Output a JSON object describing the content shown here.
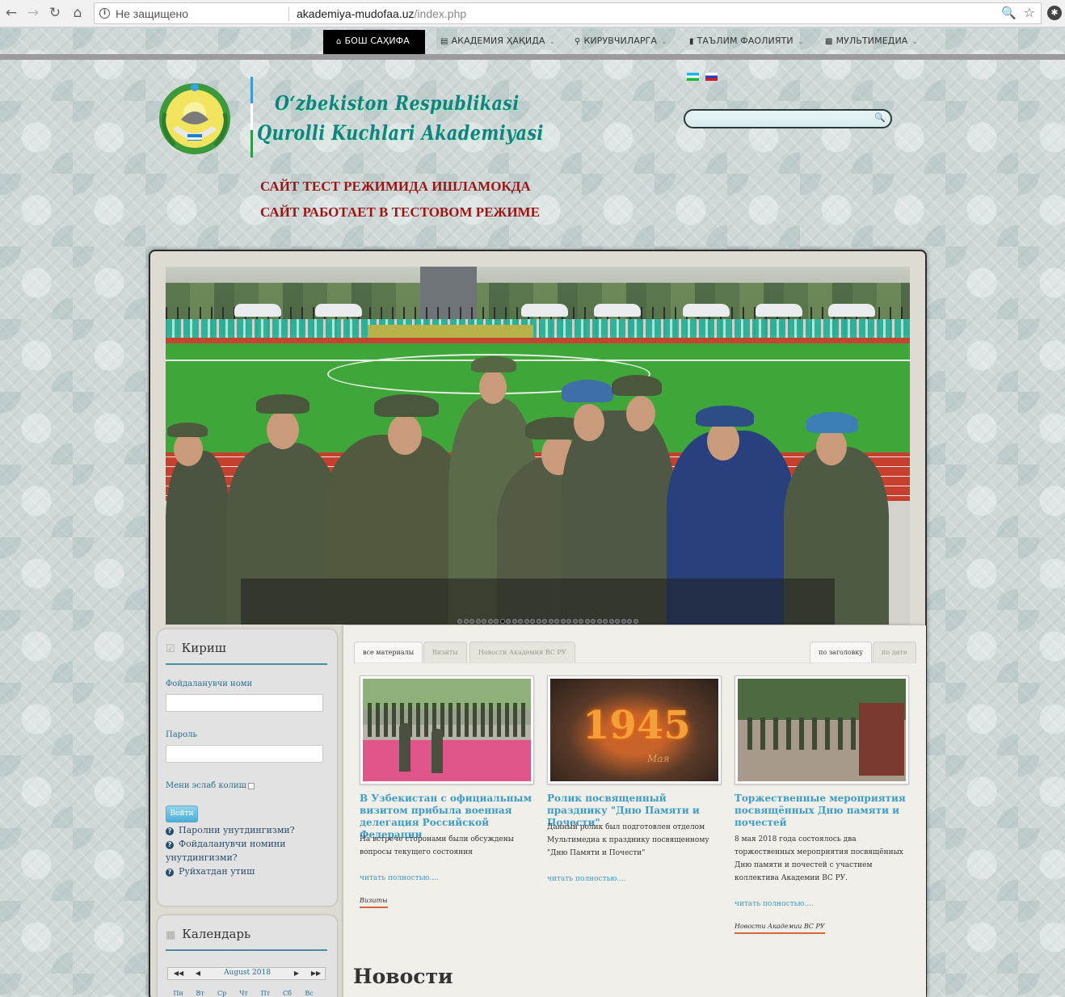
{
  "browser": {
    "security_label": "Не защищено",
    "url_domain": "akademiya-mudofaa.uz",
    "url_path": "/index.php"
  },
  "nav": {
    "items": [
      {
        "label": "БОШ САҲИФА",
        "icon": "home-icon"
      },
      {
        "label": "АКАДЕМИЯ ҲАҚИДА",
        "icon": "list-icon"
      },
      {
        "label": "КИРУВЧИЛАРГА",
        "icon": "search-icon"
      },
      {
        "label": "ТАЪЛИМ ФАОЛИЯТИ",
        "icon": "book-icon"
      },
      {
        "label": "МУЛЬТИМЕДИА",
        "icon": "camera-icon"
      }
    ]
  },
  "header": {
    "logo_line1": "O‘zbekiston Respublikasi",
    "logo_line2": "Qurolli Kuchlari Akademiyasi",
    "notice_uz": "САЙТ ТЕСТ РЕЖИМИДА ИШЛАМОКДА",
    "notice_ru": "САЙТ РАБОТАЕТ В ТЕСТОВОМ РЕЖИМЕ",
    "languages": [
      "uz",
      "ru"
    ]
  },
  "login": {
    "title": "Кириш",
    "username_label": "Фойдаланувчи номи",
    "password_label": "Пароль",
    "remember_label": "Мени эслаб колиш",
    "submit_label": "Войти",
    "links": [
      "Паролни унутдингизми?",
      "Фойдаланувчи номини унутдингизми?",
      "Руйхатдан утиш"
    ]
  },
  "calendar": {
    "title": "Календарь",
    "month": "August 2018",
    "prev_year": "◀◀",
    "prev_month": "◀",
    "next_month": "▶",
    "next_year": "▶▶",
    "weekdays": [
      "Пн",
      "Вт",
      "Ср",
      "Чт",
      "Пт",
      "Сб",
      "Вс"
    ]
  },
  "slider": {
    "dots_total": 30,
    "active_dot": 7
  },
  "tabs": {
    "left": [
      "все материалы",
      "Визиты",
      "Новости Академии ВС РУ"
    ],
    "right": [
      "по заголовку",
      "по дате"
    ]
  },
  "cards": [
    {
      "title": "В Узбекистан с официальным визитом прибыла военная делегация Российской Федерации",
      "text": "На встрече сторонами были обсуждены вопросы текущего состояния",
      "more": "читать полностью....",
      "category": "Визиты"
    },
    {
      "title": "Ролик посвященный празднику \"Дню Памяти и Почести\"",
      "text": "Данный ролик был подготовлен отделом Мультимедиа к празднику посвященному \"Дню Памяти и Почести\"",
      "more": "читать полностью....",
      "category": ""
    },
    {
      "title": "Торжественные мероприятия посвящённых Дню памяти и почестей",
      "text": "8 мая 2018 года состоялось два торжественных мероприятия посвящённых Дню памяти и почестей с участием коллектива Академии ВС РУ.",
      "more": "читать полностью....",
      "category": "Новости Академии ВС РУ"
    }
  ],
  "news_heading": "Новости",
  "card2_image_text": "1945",
  "card2_image_sub": "Мая"
}
